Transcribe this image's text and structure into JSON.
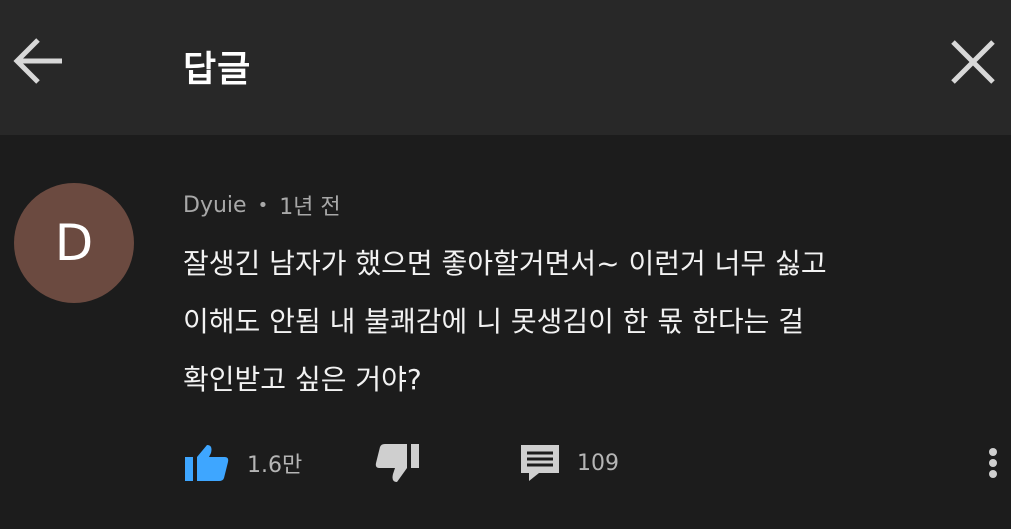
{
  "header": {
    "title": "답글",
    "back_icon": "arrow-left-icon",
    "close_icon": "close-icon"
  },
  "comment": {
    "avatar_letter": "D",
    "avatar_color": "#6b4a40",
    "author": "Dyuie",
    "separator": "•",
    "time": "1년 전",
    "lines": [
      "잘생긴 남자가 했으면 좋아할거면서~ 이런거 너무 싫고",
      "이해도 안됨 내 불쾌감에 니 못생김이 한 몫 한다는 걸",
      "확인받고 싶은 거야?"
    ],
    "likes": "1.6만",
    "replies": "109",
    "like_color": "#3ea6ff"
  }
}
